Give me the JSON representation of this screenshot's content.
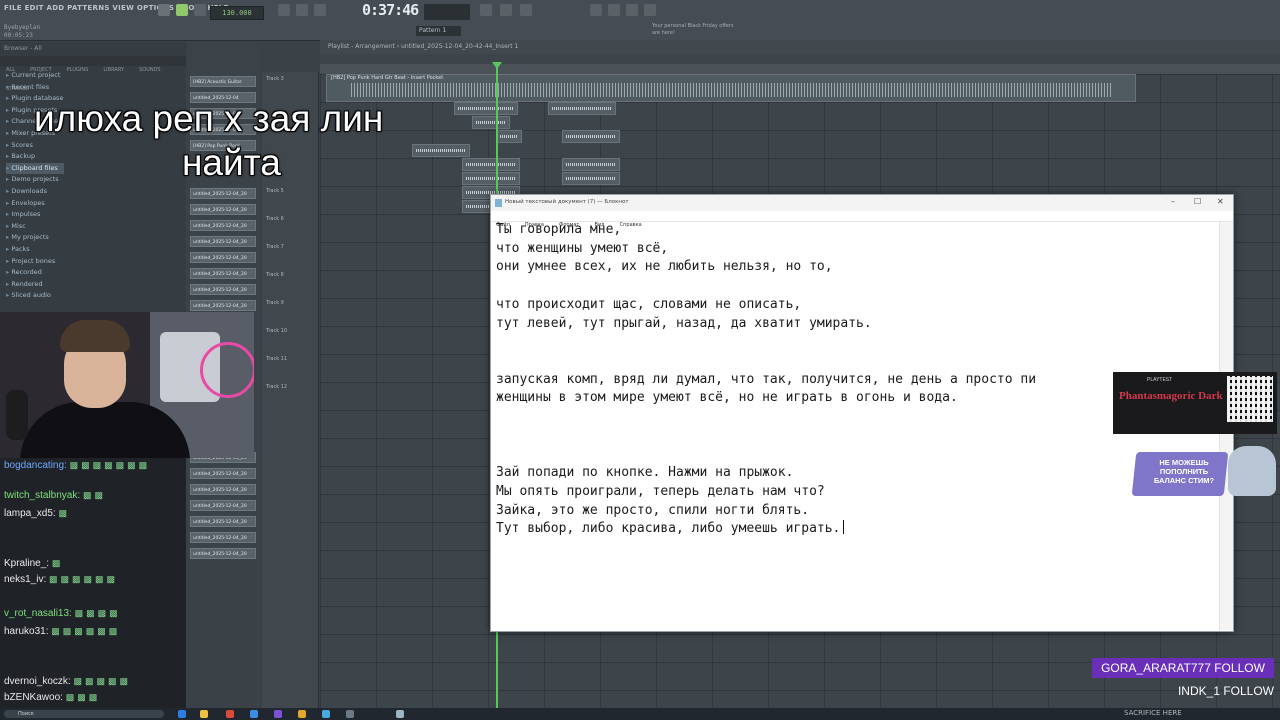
{
  "toolbar": {
    "menu": "FILE EDIT ADD PATTERNS VIEW OPTIONS TOOLS HELP",
    "project_name": "Byebyeplan",
    "project_time": "00:05:23",
    "tempo": "130.000",
    "time": "0:37:46",
    "pattern": "Pattern 1",
    "hint": "Your personal Black Friday offers are here!"
  },
  "browser": {
    "title": "Browser - All",
    "tabs": [
      "ALL",
      "PROJECT",
      "PLUGINS",
      "LIBRARY",
      "SOUNDS",
      "STARRED"
    ],
    "items": [
      "Current project",
      "Recent files",
      "Plugin database",
      "Plugin presets",
      "Channel presets",
      "Mixer presets",
      "Scores",
      "Backup",
      "Clipboard files",
      "Demo projects",
      "Downloads",
      "Envelopes",
      "Impulses",
      "Misc",
      "My projects",
      "Packs",
      "Project bones",
      "Recorded",
      "Rendered",
      "Sliced audio"
    ]
  },
  "channel_clips": [
    "[HB2] Acoustic Guitar",
    "untitled_2025-12-04",
    "untitled_2025-12-04",
    "untitled_2025-12-04",
    "untitled_2025-12-04",
    "[HB2] Pop Punk Rock",
    "untitled_2025-12-04_20",
    "untitled_2025-12-04_20",
    "untitled_2025-12-04_20",
    "untitled_2025-12-04_20",
    "untitled_2025-12-04_20",
    "untitled_2025-12-04_20",
    "untitled_2025-12-04_20",
    "untitled_2025-12-04_20",
    "untitled_2025-12-04_20",
    "untitled_2025-12-04_20",
    "untitled_2025-12-04_20",
    "untitled_2025-12-04_20",
    "untitled_2025-12-04_20",
    "untitled_2025-12-04_20",
    "untitled_2025-12-04_20",
    "untitled_2025-12-04_20",
    "untitled_2025-12-04_20",
    "untitled_2025-12-04_20"
  ],
  "tracks": [
    "Track 3",
    "Track 5",
    "Track 6",
    "Track 7",
    "Track 8",
    "Track 9",
    "Track 10",
    "Track 11",
    "Track 12"
  ],
  "playlist": {
    "header": "Playlist - Arrangement › untitled_2025-12-04_20-42-44_Insert 1",
    "main_clip_label": "[HB2] Pop Punk Hard Gtr Beat - Insert Pocket"
  },
  "overlay_title": {
    "line1": "илюха реп х зая лин",
    "line2": "найта"
  },
  "notepad": {
    "title": "Новый текстовый документ (7) — Блокнот",
    "menu": [
      "Файл",
      "Правка",
      "Формат",
      "Вид",
      "Справка"
    ],
    "lines": [
      "Ты говорила мне,",
      "что женщины умеют всё,",
      "они умнее всех, их не любить нельзя, но то,",
      "",
      "что происходит щас, словами не описать,",
      "тут левей, тут прыгай, назад, да хватит умирать.",
      "",
      "",
      "запуская комп, вряд ли думал, что так, получится, не день а просто пи",
      "женщины в этом мире умеют всё, но не играть в огонь и вода.",
      "",
      "",
      "",
      "Зай попади по кнопке. Нажми на прыжок.",
      "Мы опять проиграли, теперь делать нам что?",
      "Зайка, это же просто, спили ногти блять.",
      "Тут выбор, либо красива, либо умеешь играть."
    ]
  },
  "chat": [
    {
      "user": "bogdancating:",
      "color": "#6ea8ff"
    },
    {
      "user": "twitch_stalbnyak:",
      "color": "#7ee07e"
    },
    {
      "user": "lampa_xd5:",
      "color": "#e0e0e0"
    },
    {
      "user": "Kpraline_:",
      "color": "#e0e0e0"
    },
    {
      "user": "neks1_iv:",
      "color": "#e0e0e0"
    },
    {
      "user": "v_rot_nasali13:",
      "color": "#7ee07e"
    },
    {
      "user": "haruko31:",
      "color": "#e0e0e0"
    },
    {
      "user": "dvernoi_koczk:",
      "color": "#e0e0e0"
    },
    {
      "user": "bZENKawoo:",
      "color": "#e0e0e0"
    }
  ],
  "ad_top": {
    "heading": "PLAYTEST",
    "title": "Phantasmagoric Dark"
  },
  "ad_bottom": {
    "text": "НЕ МОЖЕШЬ ПОПОЛНИТЬ БАЛАНС СТИМ?"
  },
  "follow_alerts": [
    "GORA_ARARAT777  FOLLOW",
    "INDK_1  FOLLOW"
  ],
  "taskbar": {
    "search_placeholder": "Поиск",
    "clock": "SACRIFICE HERE"
  },
  "colors": {
    "playhead": "#58c85a",
    "follow_accent": "#6a2fb8",
    "fl_bg": "#3a4147"
  }
}
